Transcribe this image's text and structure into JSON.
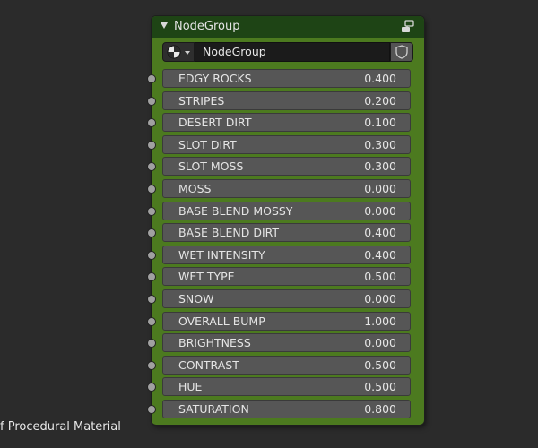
{
  "node": {
    "title": "NodeGroup",
    "group_name": "NodeGroup",
    "header_color": "#1e4415",
    "body_color": "#4c7a1f",
    "inputs": [
      {
        "label": "EDGY ROCKS",
        "value": "0.400"
      },
      {
        "label": "STRIPES",
        "value": "0.200"
      },
      {
        "label": "DESERT DIRT",
        "value": "0.100"
      },
      {
        "label": "SLOT DIRT",
        "value": "0.300"
      },
      {
        "label": "SLOT MOSS",
        "value": "0.300"
      },
      {
        "label": "MOSS",
        "value": "0.000"
      },
      {
        "label": "BASE BLEND MOSSY",
        "value": "0.000"
      },
      {
        "label": "BASE BLEND DIRT",
        "value": "0.400"
      },
      {
        "label": "WET INTENSITY",
        "value": "0.400"
      },
      {
        "label": "WET TYPE",
        "value": "0.500"
      },
      {
        "label": "SNOW",
        "value": "0.000"
      },
      {
        "label": "OVERALL BUMP",
        "value": "1.000"
      },
      {
        "label": "BRIGHTNESS",
        "value": "0.000"
      },
      {
        "label": "CONTRAST",
        "value": "0.500"
      },
      {
        "label": "HUE",
        "value": "0.500"
      },
      {
        "label": "SATURATION",
        "value": "0.800"
      }
    ]
  },
  "icons": {
    "collapse": "chevron-down-icon",
    "group": "node-group-icon",
    "browse": "material-sphere-icon",
    "fake_user": "shield-icon"
  },
  "footer_label": "f Procedural Material"
}
